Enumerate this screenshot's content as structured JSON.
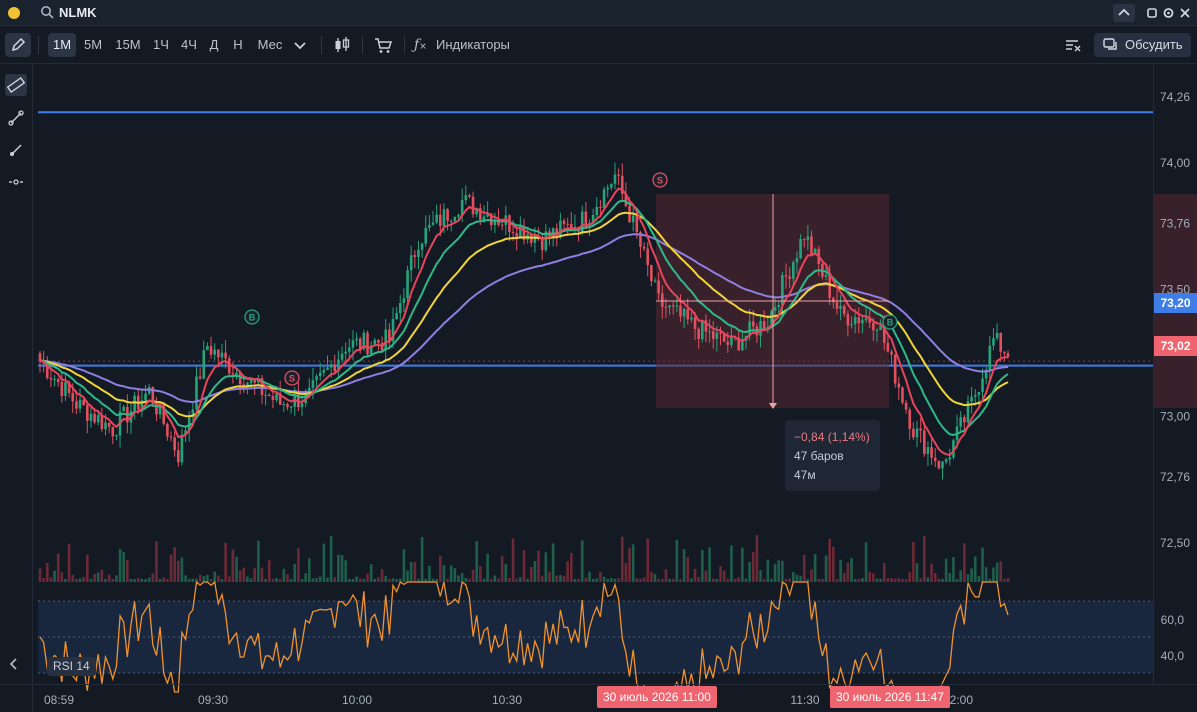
{
  "window": {
    "ticker": "NLMK"
  },
  "toolbar": {
    "timeframes": [
      "1M",
      "5M",
      "15M",
      "1Ч",
      "4Ч",
      "Д",
      "Н",
      "Мес"
    ],
    "active_timeframe": "1M",
    "indicators_label": "Индикаторы",
    "discuss_label": "Обсудить"
  },
  "price_axis": {
    "labels": [
      "74,26",
      "74,00",
      "73,76",
      "73,50",
      "73,26",
      "73,00",
      "72,76",
      "72,50"
    ],
    "current_price": "73,20",
    "current_price_color": "#3f7ee8",
    "measure_price": "73,02",
    "measure_price_color": "#f0646f"
  },
  "rsi_axis": {
    "labels": [
      "60,0",
      "40,0"
    ]
  },
  "time_axis": {
    "labels": [
      "08:59",
      "09:30",
      "10:00",
      "10:30",
      "11:30",
      "12:00"
    ],
    "marker_start": "30 июль 2026 11:00",
    "marker_end": "30 июль 2026 11:47"
  },
  "measure_tooltip": {
    "delta": "−0,84 (1,14%)",
    "bars": "47 баров",
    "duration": "47м"
  },
  "trade_markers": [
    "B",
    "S",
    "S",
    "B"
  ],
  "indicator_pane": {
    "label": "RSI 14"
  },
  "colors": {
    "up": "#26a37a",
    "down": "#e2505f",
    "ema_red": "#e8445a",
    "ema_green": "#2fb88a",
    "ema_yellow": "#f0d43a",
    "ema_purple": "#8e7fe0",
    "rsi_line": "#f0922e",
    "level_line": "#3f7ee8"
  }
}
